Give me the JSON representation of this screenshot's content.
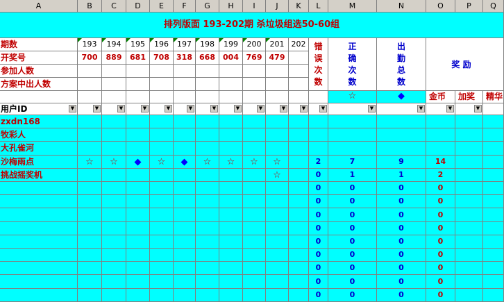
{
  "columns": [
    "A",
    "B",
    "C",
    "D",
    "E",
    "F",
    "G",
    "H",
    "I",
    "J",
    "K",
    "L",
    "M",
    "N",
    "O",
    "P",
    "Q"
  ],
  "title": "排列版面 193-202期 杀垃圾组选50-60组",
  "row_labels": {
    "period": "期数",
    "draw": "开奖号",
    "participants": "参加人数",
    "plan_hits": "方案中出人数",
    "user_id": "用户ID"
  },
  "periods": [
    "193",
    "194",
    "195",
    "196",
    "197",
    "198",
    "199",
    "200",
    "201",
    "202"
  ],
  "draws": [
    "700",
    "889",
    "681",
    "708",
    "318",
    "668",
    "004",
    "769",
    "479",
    ""
  ],
  "headers": {
    "errors": "错误次数",
    "correct": "正确次数",
    "attendance": "出勤总数",
    "reward": "奖 励",
    "gold": "金币",
    "bonus": "加奖",
    "elite": "精华"
  },
  "symbols": {
    "star": "☆",
    "diamond": "◆"
  },
  "users": [
    {
      "id": "zxdn168",
      "marks": [
        "",
        "",
        "",
        "",
        "",
        "",
        "",
        "",
        "",
        ""
      ],
      "errors": "",
      "correct": "",
      "attendance": "",
      "gold": ""
    },
    {
      "id": "牧彩人",
      "marks": [
        "",
        "",
        "",
        "",
        "",
        "",
        "",
        "",
        "",
        ""
      ],
      "errors": "",
      "correct": "",
      "attendance": "",
      "gold": ""
    },
    {
      "id": "大孔雀河",
      "marks": [
        "",
        "",
        "",
        "",
        "",
        "",
        "",
        "",
        "",
        ""
      ],
      "errors": "",
      "correct": "",
      "attendance": "",
      "gold": ""
    },
    {
      "id": "沙梅雨点",
      "marks": [
        "☆",
        "☆",
        "◆",
        "☆",
        "◆",
        "☆",
        "☆",
        "☆",
        "☆",
        ""
      ],
      "errors": "2",
      "correct": "7",
      "attendance": "9",
      "gold": "14"
    },
    {
      "id": "挑战摇奖机",
      "marks": [
        "",
        "",
        "",
        "",
        "",
        "",
        "",
        "",
        "☆",
        ""
      ],
      "errors": "0",
      "correct": "1",
      "attendance": "1",
      "gold": "2"
    },
    {
      "id": "",
      "marks": [
        "",
        "",
        "",
        "",
        "",
        "",
        "",
        "",
        "",
        ""
      ],
      "errors": "0",
      "correct": "0",
      "attendance": "0",
      "gold": "0"
    },
    {
      "id": "",
      "marks": [
        "",
        "",
        "",
        "",
        "",
        "",
        "",
        "",
        "",
        ""
      ],
      "errors": "0",
      "correct": "0",
      "attendance": "0",
      "gold": "0"
    },
    {
      "id": "",
      "marks": [
        "",
        "",
        "",
        "",
        "",
        "",
        "",
        "",
        "",
        ""
      ],
      "errors": "0",
      "correct": "0",
      "attendance": "0",
      "gold": "0"
    },
    {
      "id": "",
      "marks": [
        "",
        "",
        "",
        "",
        "",
        "",
        "",
        "",
        "",
        ""
      ],
      "errors": "0",
      "correct": "0",
      "attendance": "0",
      "gold": "0"
    },
    {
      "id": "",
      "marks": [
        "",
        "",
        "",
        "",
        "",
        "",
        "",
        "",
        "",
        ""
      ],
      "errors": "0",
      "correct": "0",
      "attendance": "0",
      "gold": "0"
    },
    {
      "id": "",
      "marks": [
        "",
        "",
        "",
        "",
        "",
        "",
        "",
        "",
        "",
        ""
      ],
      "errors": "0",
      "correct": "0",
      "attendance": "0",
      "gold": "0"
    },
    {
      "id": "",
      "marks": [
        "",
        "",
        "",
        "",
        "",
        "",
        "",
        "",
        "",
        ""
      ],
      "errors": "0",
      "correct": "0",
      "attendance": "0",
      "gold": "0"
    },
    {
      "id": "",
      "marks": [
        "",
        "",
        "",
        "",
        "",
        "",
        "",
        "",
        "",
        ""
      ],
      "errors": "0",
      "correct": "0",
      "attendance": "0",
      "gold": "0"
    },
    {
      "id": "",
      "marks": [
        "",
        "",
        "",
        "",
        "",
        "",
        "",
        "",
        "",
        ""
      ],
      "errors": "0",
      "correct": "0",
      "attendance": "0",
      "gold": "0"
    }
  ]
}
